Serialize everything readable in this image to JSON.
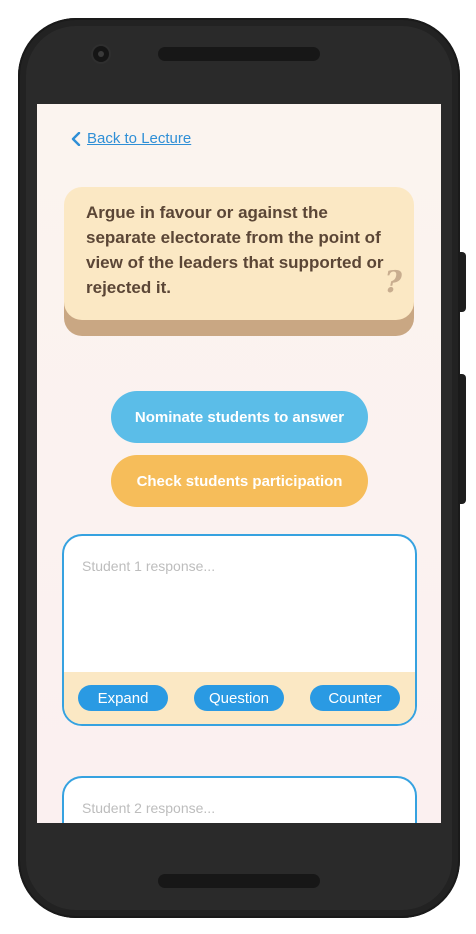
{
  "nav": {
    "back_label": "Back to Lecture"
  },
  "question": {
    "text": "Argue in favour or against the separate electorate from the point of view of the leaders that supported or rejected it.",
    "mark": "?"
  },
  "actions": {
    "nominate_label": "Nominate students to answer",
    "check_label": "Check students participation"
  },
  "responses": [
    {
      "placeholder": "Student 1 response...",
      "buttons": [
        "Expand",
        "Question",
        "Counter"
      ]
    },
    {
      "placeholder": "Student 2 response..."
    }
  ],
  "colors": {
    "accent_blue": "#2a9ae3",
    "nominate_button": "#5bbde8",
    "check_button": "#f6bd5a",
    "card_face": "#fbe8c4",
    "card_shadow": "#c9a783",
    "card_text": "#5b4636"
  },
  "icons": {
    "back": "chevron-left-icon",
    "question_mark": "question-mark-icon"
  }
}
